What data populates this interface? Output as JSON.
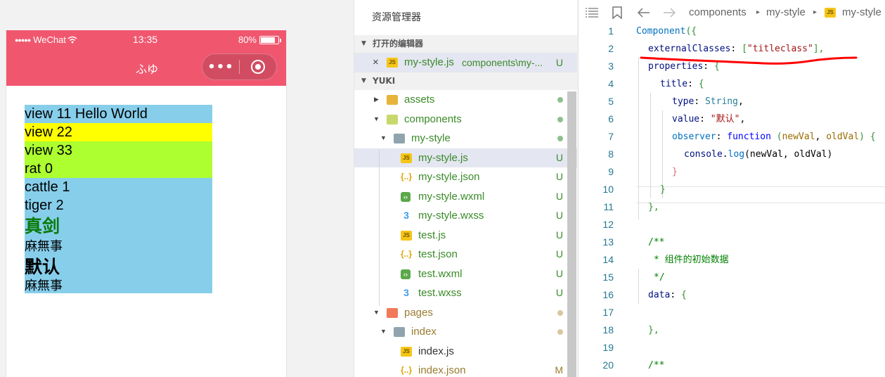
{
  "simulator": {
    "status": {
      "signal_dots": "●●●●●",
      "carrier": "WeChat",
      "time": "13:35",
      "battery": "80%"
    },
    "nav_title": "ふゆ",
    "capsule_more": "•••",
    "rows": [
      "view 11 Hello World",
      "view 22",
      "view 33",
      "rat 0",
      "cattle 1",
      "tiger 2",
      "真剑",
      "麻無事",
      "默认",
      "麻無事"
    ]
  },
  "explorer": {
    "title": "资源管理器",
    "open_editors_label": "打开的编辑器",
    "open_editor": {
      "close": "×",
      "name": "my-style.js",
      "path": "components\\my-...",
      "status": "U"
    },
    "workspace_label": "YUKI",
    "tree": [
      {
        "name": "assets"
      },
      {
        "name": "components"
      },
      {
        "name": "my-style"
      },
      {
        "name": "my-style.js",
        "status": "U"
      },
      {
        "name": "my-style.json",
        "status": "U"
      },
      {
        "name": "my-style.wxml",
        "status": "U"
      },
      {
        "name": "my-style.wxss",
        "status": "U"
      },
      {
        "name": "test.js",
        "status": "U"
      },
      {
        "name": "test.json",
        "status": "U"
      },
      {
        "name": "test.wxml",
        "status": "U"
      },
      {
        "name": "test.wxss",
        "status": "U"
      },
      {
        "name": "pages"
      },
      {
        "name": "index"
      },
      {
        "name": "index.js"
      },
      {
        "name": "index.json",
        "status": "M"
      }
    ]
  },
  "editor": {
    "breadcrumb": [
      "components",
      "my-style",
      "my-style"
    ],
    "breadcrumb_sep": "▸",
    "line_numbers": [
      "1",
      "2",
      "3",
      "4",
      "5",
      "6",
      "7",
      "8",
      "9",
      "10",
      "11",
      "12",
      "13",
      "14",
      "15",
      "16",
      "17",
      "18",
      "19",
      "20"
    ],
    "code": {
      "l1_a": "Component",
      "l1_b": "({",
      "l2_a": "externalClasses",
      "l2_b": ": ",
      "l2_c": "[",
      "l2_d": "\"titleclass\"",
      "l2_e": "],",
      "l3_a": "properties",
      "l3_b": ": ",
      "l3_c": "{",
      "l4_a": "title",
      "l4_b": ": ",
      "l4_c": "{",
      "l5_a": "type",
      "l5_b": ": ",
      "l5_c": "String",
      "l5_d": ",",
      "l6_a": "value",
      "l6_b": ": ",
      "l6_c": "\"默认\"",
      "l6_d": ",",
      "l7_a": "observer",
      "l7_b": ": ",
      "l7_c": "function",
      "l7_d": " (",
      "l7_e": "newVal",
      "l7_f": ", ",
      "l7_g": "oldVal",
      "l7_h": ") ",
      "l7_i": "{",
      "l8_a": "console",
      "l8_b": ".",
      "l8_c": "log",
      "l8_d": "(newVal, oldVal)",
      "l9": "}",
      "l10": "}",
      "l11": "},",
      "l13": "/**",
      "l14": "* 组件的初始数据",
      "l15": "*/",
      "l16_a": "data",
      "l16_b": ": ",
      "l16_c": "{",
      "l18": "},",
      "l20": "/**"
    }
  },
  "colors": {
    "nav_bar": "#f0576f",
    "sky": "#87ceeb",
    "yellow": "#ffff00",
    "green_yellow": "#adff2f",
    "annotation": "#ff0000"
  }
}
